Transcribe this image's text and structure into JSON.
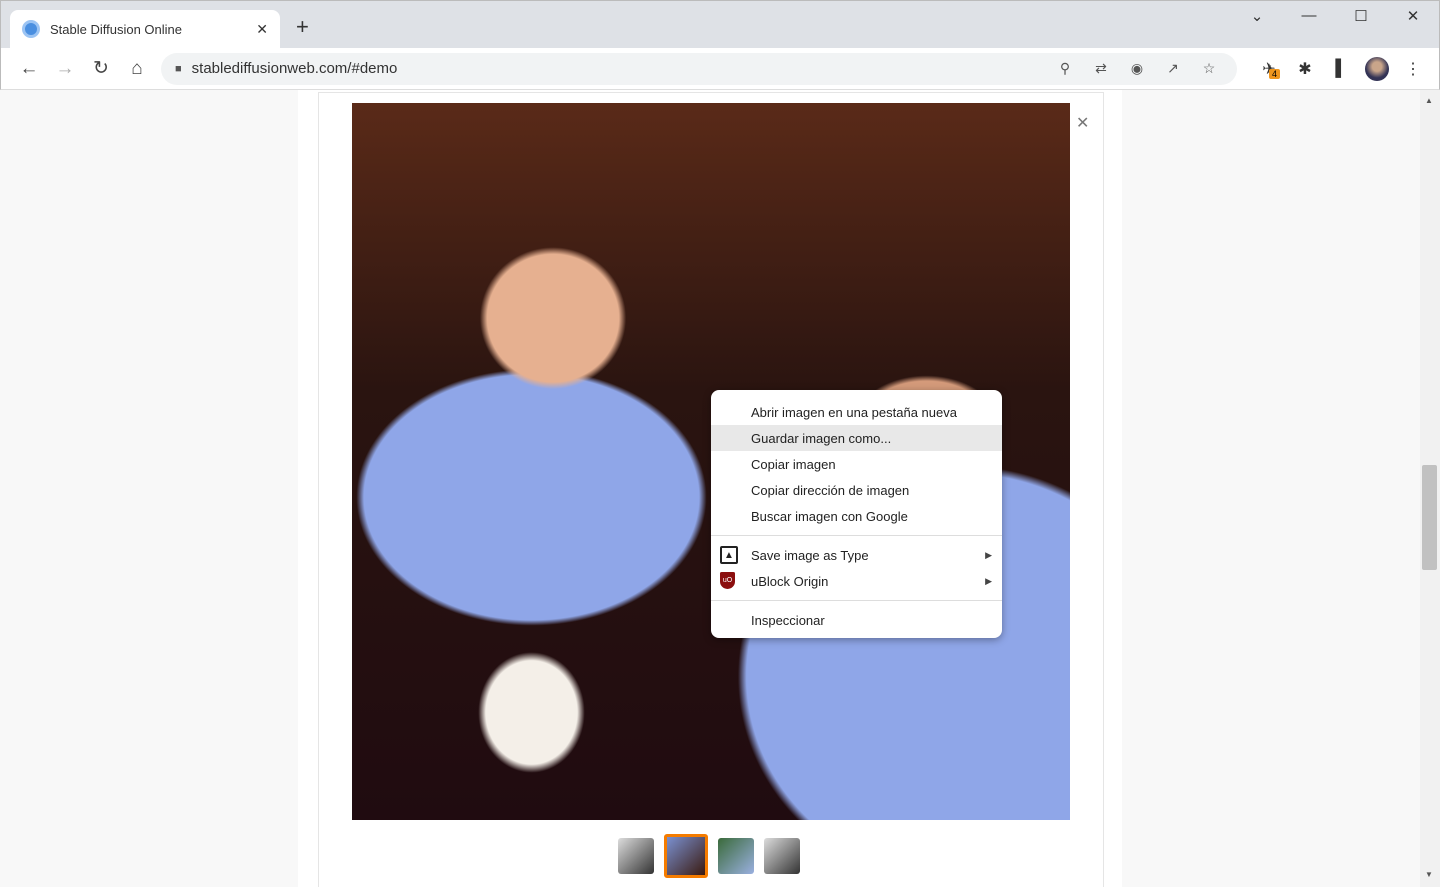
{
  "tab": {
    "title": "Stable Diffusion Online",
    "favicon": "stable-diffusion-icon"
  },
  "toolbar": {
    "url": "stablediffusionweb.com/#demo",
    "extension_badge": "4"
  },
  "window_controls": {
    "tab_search": "⌄",
    "minimize": "—",
    "maximize": "☐",
    "close": "✕"
  },
  "context_menu": {
    "items": [
      {
        "label": "Abrir imagen en una pestaña nueva"
      },
      {
        "label": "Guardar imagen como...",
        "highlighted": true
      },
      {
        "label": "Copiar imagen"
      },
      {
        "label": "Copiar dirección de imagen"
      },
      {
        "label": "Buscar imagen con Google"
      }
    ],
    "extensions": [
      {
        "label": "Save image as Type",
        "icon": "image-icon"
      },
      {
        "label": "uBlock Origin",
        "icon": "ublock-icon",
        "icon_text": "uO"
      }
    ],
    "inspect": "Inspeccionar"
  },
  "gallery": {
    "thumbnail_count": 4,
    "selected_index": 1,
    "accent": "#f57c00"
  }
}
